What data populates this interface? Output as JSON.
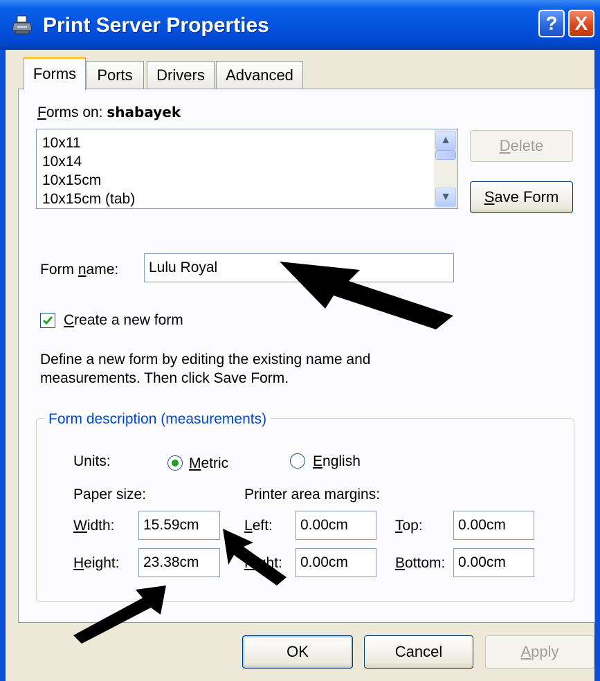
{
  "window": {
    "title": "Print Server Properties",
    "help_label": "?",
    "close_label": "X",
    "icon": "printer-icon"
  },
  "tabs": [
    {
      "label": "Forms",
      "active": true
    },
    {
      "label": "Ports",
      "active": false
    },
    {
      "label": "Drivers",
      "active": false
    },
    {
      "label": "Advanced",
      "active": false
    }
  ],
  "forms": {
    "forms_on_label_prefix": "F",
    "forms_on_label_rest": "orms on:",
    "server_name": "shabayek",
    "list_items": [
      "10x11",
      "10x14",
      "10x15cm",
      "10x15cm (tab)"
    ],
    "delete_prefix": "D",
    "delete_rest": "elete",
    "save_prefix": "S",
    "save_rest": "ave Form",
    "form_name_label_a": "Form ",
    "form_name_label_u": "n",
    "form_name_label_b": "ame:",
    "form_name_value": "Lulu Royal",
    "create_new_prefix": "C",
    "create_new_rest": "reate a new form",
    "create_new_checked": true,
    "description_line1": "Define a new form by editing the existing name and",
    "description_line2": "measurements.  Then click Save Form."
  },
  "measurements": {
    "group_title": "Form description (measurements)",
    "units_label": "Units:",
    "metric_prefix": "M",
    "metric_rest": "etric",
    "metric_selected": true,
    "english_prefix": "E",
    "english_rest": "nglish",
    "english_selected": false,
    "paper_size_label": "Paper size:",
    "margins_label": "Printer area margins:",
    "width_prefix": "W",
    "width_rest": "idth:",
    "width_value": "15.59cm",
    "height_prefix": "H",
    "height_rest": "eight:",
    "height_value": "23.38cm",
    "left_prefix": "L",
    "left_rest": "eft:",
    "left_value": "0.00cm",
    "right_prefix": "R",
    "right_rest": "ight:",
    "right_value": "0.00cm",
    "top_prefix": "T",
    "top_rest": "op:",
    "top_value": "0.00cm",
    "bottom_prefix": "B",
    "bottom_rest": "ottom:",
    "bottom_value": "0.00cm"
  },
  "buttons": {
    "ok": "OK",
    "cancel": "Cancel",
    "apply_prefix": "A",
    "apply_rest": "pply"
  },
  "colors": {
    "title_bar": "#0554e0",
    "dialog_bg": "#ece9d8",
    "group_title": "#0046d5",
    "active_tab_highlight": "#ffc83c"
  }
}
